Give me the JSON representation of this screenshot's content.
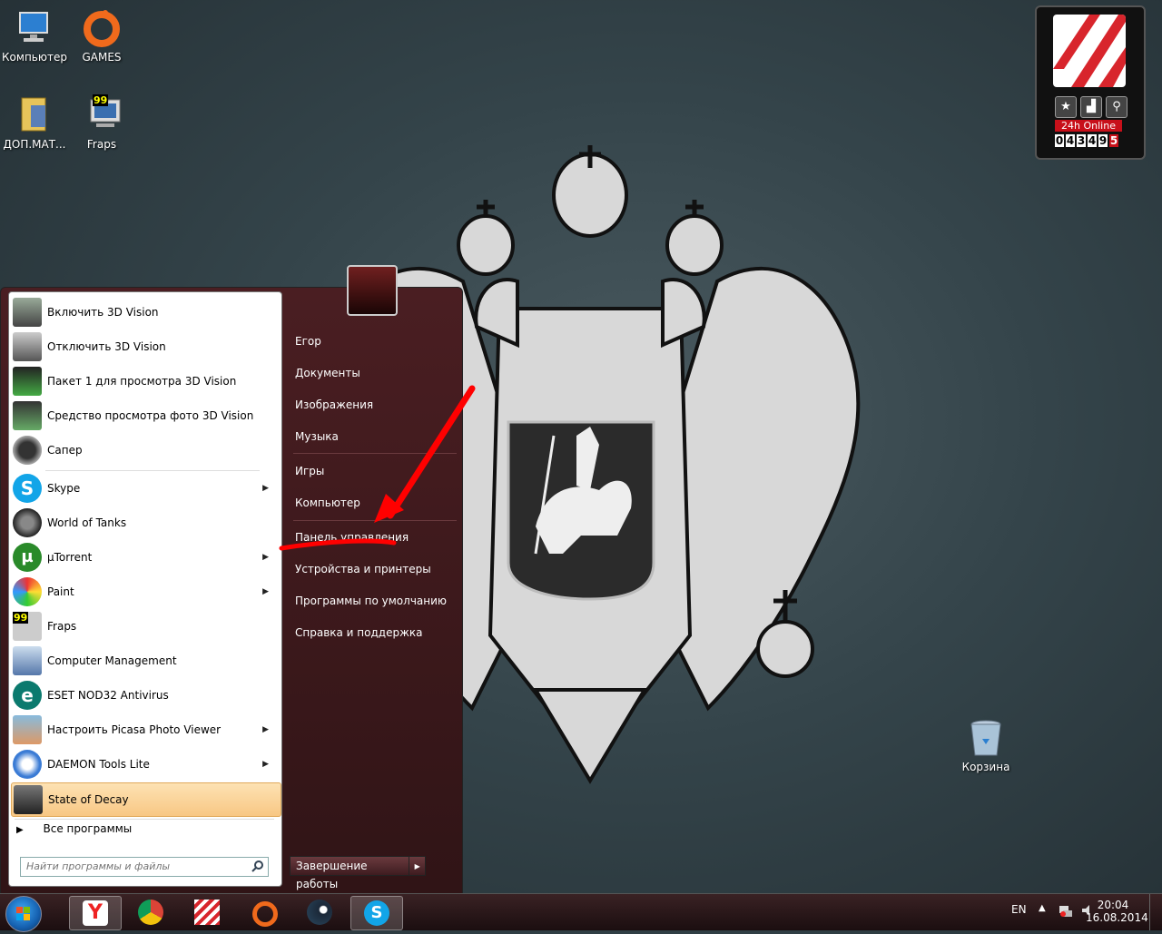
{
  "desktop": {
    "icons": [
      {
        "label": "Компьютер",
        "icon": "computer-icon"
      },
      {
        "label": "GAMES",
        "icon": "origin-icon"
      },
      {
        "label": "ДОП.МАТ...",
        "icon": "folder-icon"
      },
      {
        "label": "Fraps",
        "icon": "fraps-icon",
        "badge": "99"
      },
      {
        "label": "Корзина",
        "icon": "recycle-bin-icon"
      }
    ]
  },
  "gadget": {
    "status": "24h Online",
    "digits": [
      "0",
      "4",
      "3",
      "4",
      "9",
      "5"
    ]
  },
  "start_menu": {
    "programs": [
      {
        "label": "Включить 3D Vision",
        "icon": "nvidia-3d-vision-icon"
      },
      {
        "label": "Отключить 3D Vision",
        "icon": "nvidia-3d-vision-icon"
      },
      {
        "label": "Пакет 1 для просмотра 3D Vision",
        "icon": "3d-vision-player-icon"
      },
      {
        "label": "Средство просмотра фото 3D Vision",
        "icon": "3d-vision-photo-icon"
      },
      {
        "label": "Сапер",
        "icon": "minesweeper-icon"
      },
      {
        "label": "Skype",
        "icon": "skype-icon",
        "submenu": true
      },
      {
        "label": "World of Tanks",
        "icon": "world-of-tanks-icon"
      },
      {
        "label": "µTorrent",
        "icon": "utorrent-icon",
        "submenu": true
      },
      {
        "label": "Paint",
        "icon": "paint-icon",
        "submenu": true
      },
      {
        "label": "Fraps",
        "icon": "fraps-icon",
        "badge": "99"
      },
      {
        "label": "Computer Management",
        "icon": "computer-management-icon"
      },
      {
        "label": "ESET NOD32 Antivirus",
        "icon": "eset-icon"
      },
      {
        "label": "Настроить Picasa Photo Viewer",
        "icon": "picasa-icon",
        "submenu": true
      },
      {
        "label": "DAEMON Tools Lite",
        "icon": "daemon-tools-icon",
        "submenu": true
      },
      {
        "label": "State of Decay",
        "icon": "state-of-decay-icon",
        "highlighted": true
      }
    ],
    "all_programs": "Все программы",
    "search_placeholder": "Найти программы и файлы",
    "right_items": [
      "Егор",
      "Документы",
      "Изображения",
      "Музыка",
      "Игры",
      "Компьютер",
      "Панель управления",
      "Устройства и принтеры",
      "Программы по умолчанию",
      "Справка и поддержка"
    ],
    "shutdown_label": "Завершение работы"
  },
  "taskbar": {
    "apps": [
      "yandex-browser-icon",
      "chrome-icon",
      "game-client-icon",
      "origin-icon",
      "steam-icon",
      "skype-icon"
    ],
    "language": "EN",
    "time": "20:04",
    "date": "16.08.2014"
  },
  "colors": {
    "annotation_red": "#ff0000",
    "menu_highlight": "#f8c784"
  }
}
